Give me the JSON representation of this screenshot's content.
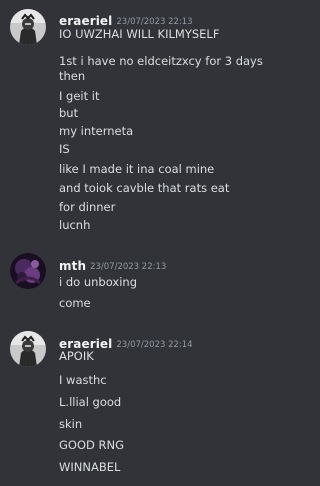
{
  "messages": [
    {
      "username": "eraeriel",
      "timestamp": "23/07/2023 22:13",
      "avatar_icon": "eraeriel-avatar-icon",
      "lines": [
        "IO UWZHAI WILL KILMYSELF",
        "1st i have no eldceitzxcy for 3 days",
        "then",
        "I geit it",
        "but",
        "my interneta",
        "IS",
        "like I made it ina coal mine",
        "and toiok cavble that rats eat",
        "for dinner",
        "lucnh"
      ]
    },
    {
      "username": "mth",
      "timestamp": "23/07/2023 22:13",
      "avatar_icon": "mth-avatar-icon",
      "lines": [
        "i do unboxing",
        "come"
      ]
    },
    {
      "username": "eraeriel",
      "timestamp": "23/07/2023 22:14",
      "avatar_icon": "eraeriel-avatar-icon",
      "lines": [
        "APOIK",
        "I wasthc",
        "L.llial good",
        "skin",
        "GOOD RNG",
        "WINNABEL"
      ]
    }
  ],
  "colors": {
    "background": "#313338",
    "username": "#f2f3f5",
    "timestamp": "#949ba4",
    "text": "#dbdee1"
  }
}
